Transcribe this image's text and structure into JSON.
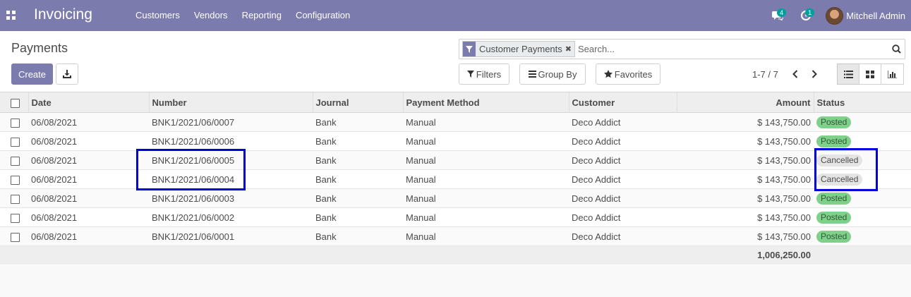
{
  "app": {
    "title": "Invoicing",
    "menu": [
      "Customers",
      "Vendors",
      "Reporting",
      "Configuration"
    ],
    "messages_count": "4",
    "activities_count": "1",
    "user_name": "Mitchell Admin"
  },
  "control_panel": {
    "title": "Payments",
    "create_label": "Create",
    "search": {
      "facet_label": "Customer Payments",
      "placeholder": "Search..."
    },
    "filters_label": "Filters",
    "group_by_label": "Group By",
    "favorites_label": "Favorites",
    "pager_value": "1-7 / 7"
  },
  "table": {
    "columns": [
      "Date",
      "Number",
      "Journal",
      "Payment Method",
      "Customer",
      "Amount",
      "Status"
    ],
    "rows": [
      {
        "date": "06/08/2021",
        "number": "BNK1/2021/06/0007",
        "journal": "Bank",
        "method": "Manual",
        "customer": "Deco Addict",
        "amount": "$ 143,750.00",
        "status": "Posted"
      },
      {
        "date": "06/08/2021",
        "number": "BNK1/2021/06/0006",
        "journal": "Bank",
        "method": "Manual",
        "customer": "Deco Addict",
        "amount": "$ 143,750.00",
        "status": "Posted"
      },
      {
        "date": "06/08/2021",
        "number": "BNK1/2021/06/0005",
        "journal": "Bank",
        "method": "Manual",
        "customer": "Deco Addict",
        "amount": "$ 143,750.00",
        "status": "Cancelled"
      },
      {
        "date": "06/08/2021",
        "number": "BNK1/2021/06/0004",
        "journal": "Bank",
        "method": "Manual",
        "customer": "Deco Addict",
        "amount": "$ 143,750.00",
        "status": "Cancelled"
      },
      {
        "date": "06/08/2021",
        "number": "BNK1/2021/06/0003",
        "journal": "Bank",
        "method": "Manual",
        "customer": "Deco Addict",
        "amount": "$ 143,750.00",
        "status": "Posted"
      },
      {
        "date": "06/08/2021",
        "number": "BNK1/2021/06/0002",
        "journal": "Bank",
        "method": "Manual",
        "customer": "Deco Addict",
        "amount": "$ 143,750.00",
        "status": "Posted"
      },
      {
        "date": "06/08/2021",
        "number": "BNK1/2021/06/0001",
        "journal": "Bank",
        "method": "Manual",
        "customer": "Deco Addict",
        "amount": "$ 143,750.00",
        "status": "Posted"
      }
    ],
    "total_amount": "1,006,250.00"
  },
  "colors": {
    "brand": "#7c7bad",
    "posted": "#7fd08a",
    "cancelled": "#e4e4e4",
    "annotation": "#0000d9"
  }
}
